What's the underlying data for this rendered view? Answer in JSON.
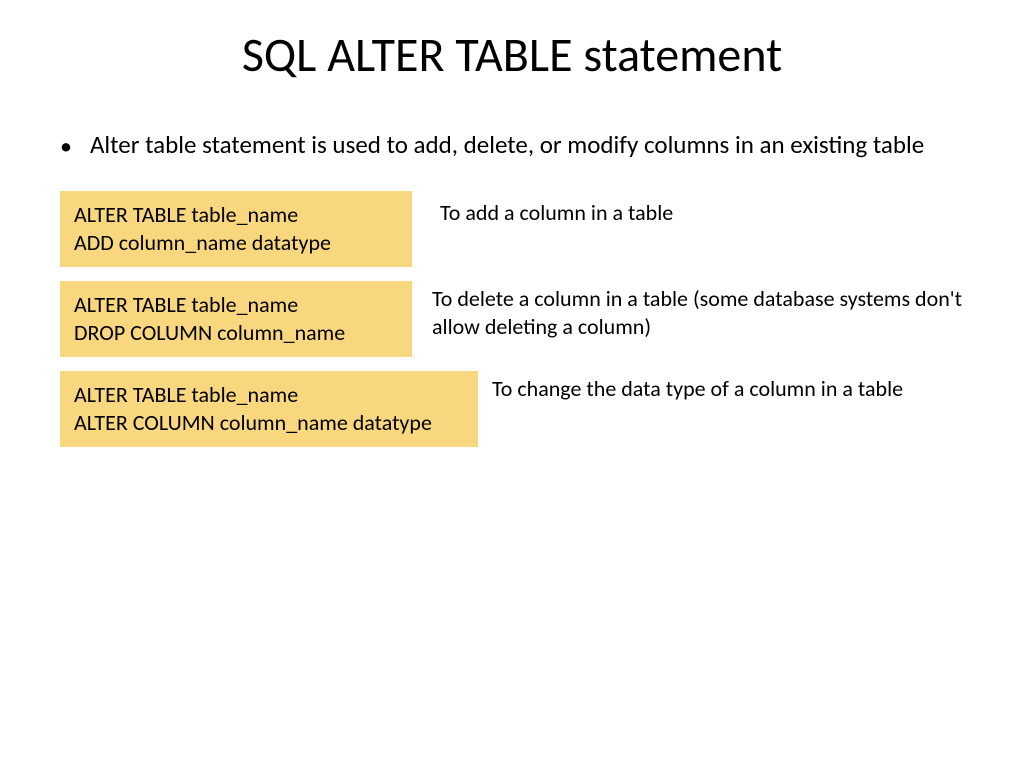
{
  "title": "SQL ALTER TABLE statement",
  "bullet": "Alter table statement is used to add, delete, or modify columns in an existing table",
  "examples": [
    {
      "code": "ALTER TABLE table_name\nADD column_name datatype",
      "explanation": "To add a column in a table"
    },
    {
      "code": "ALTER TABLE table_name\nDROP COLUMN column_name",
      "explanation": "To delete a column in a table (some database systems don't allow deleting a column)"
    },
    {
      "code": "ALTER TABLE table_name\nALTER COLUMN column_name datatype",
      "explanation": "To change the data type of a column in a table"
    }
  ]
}
